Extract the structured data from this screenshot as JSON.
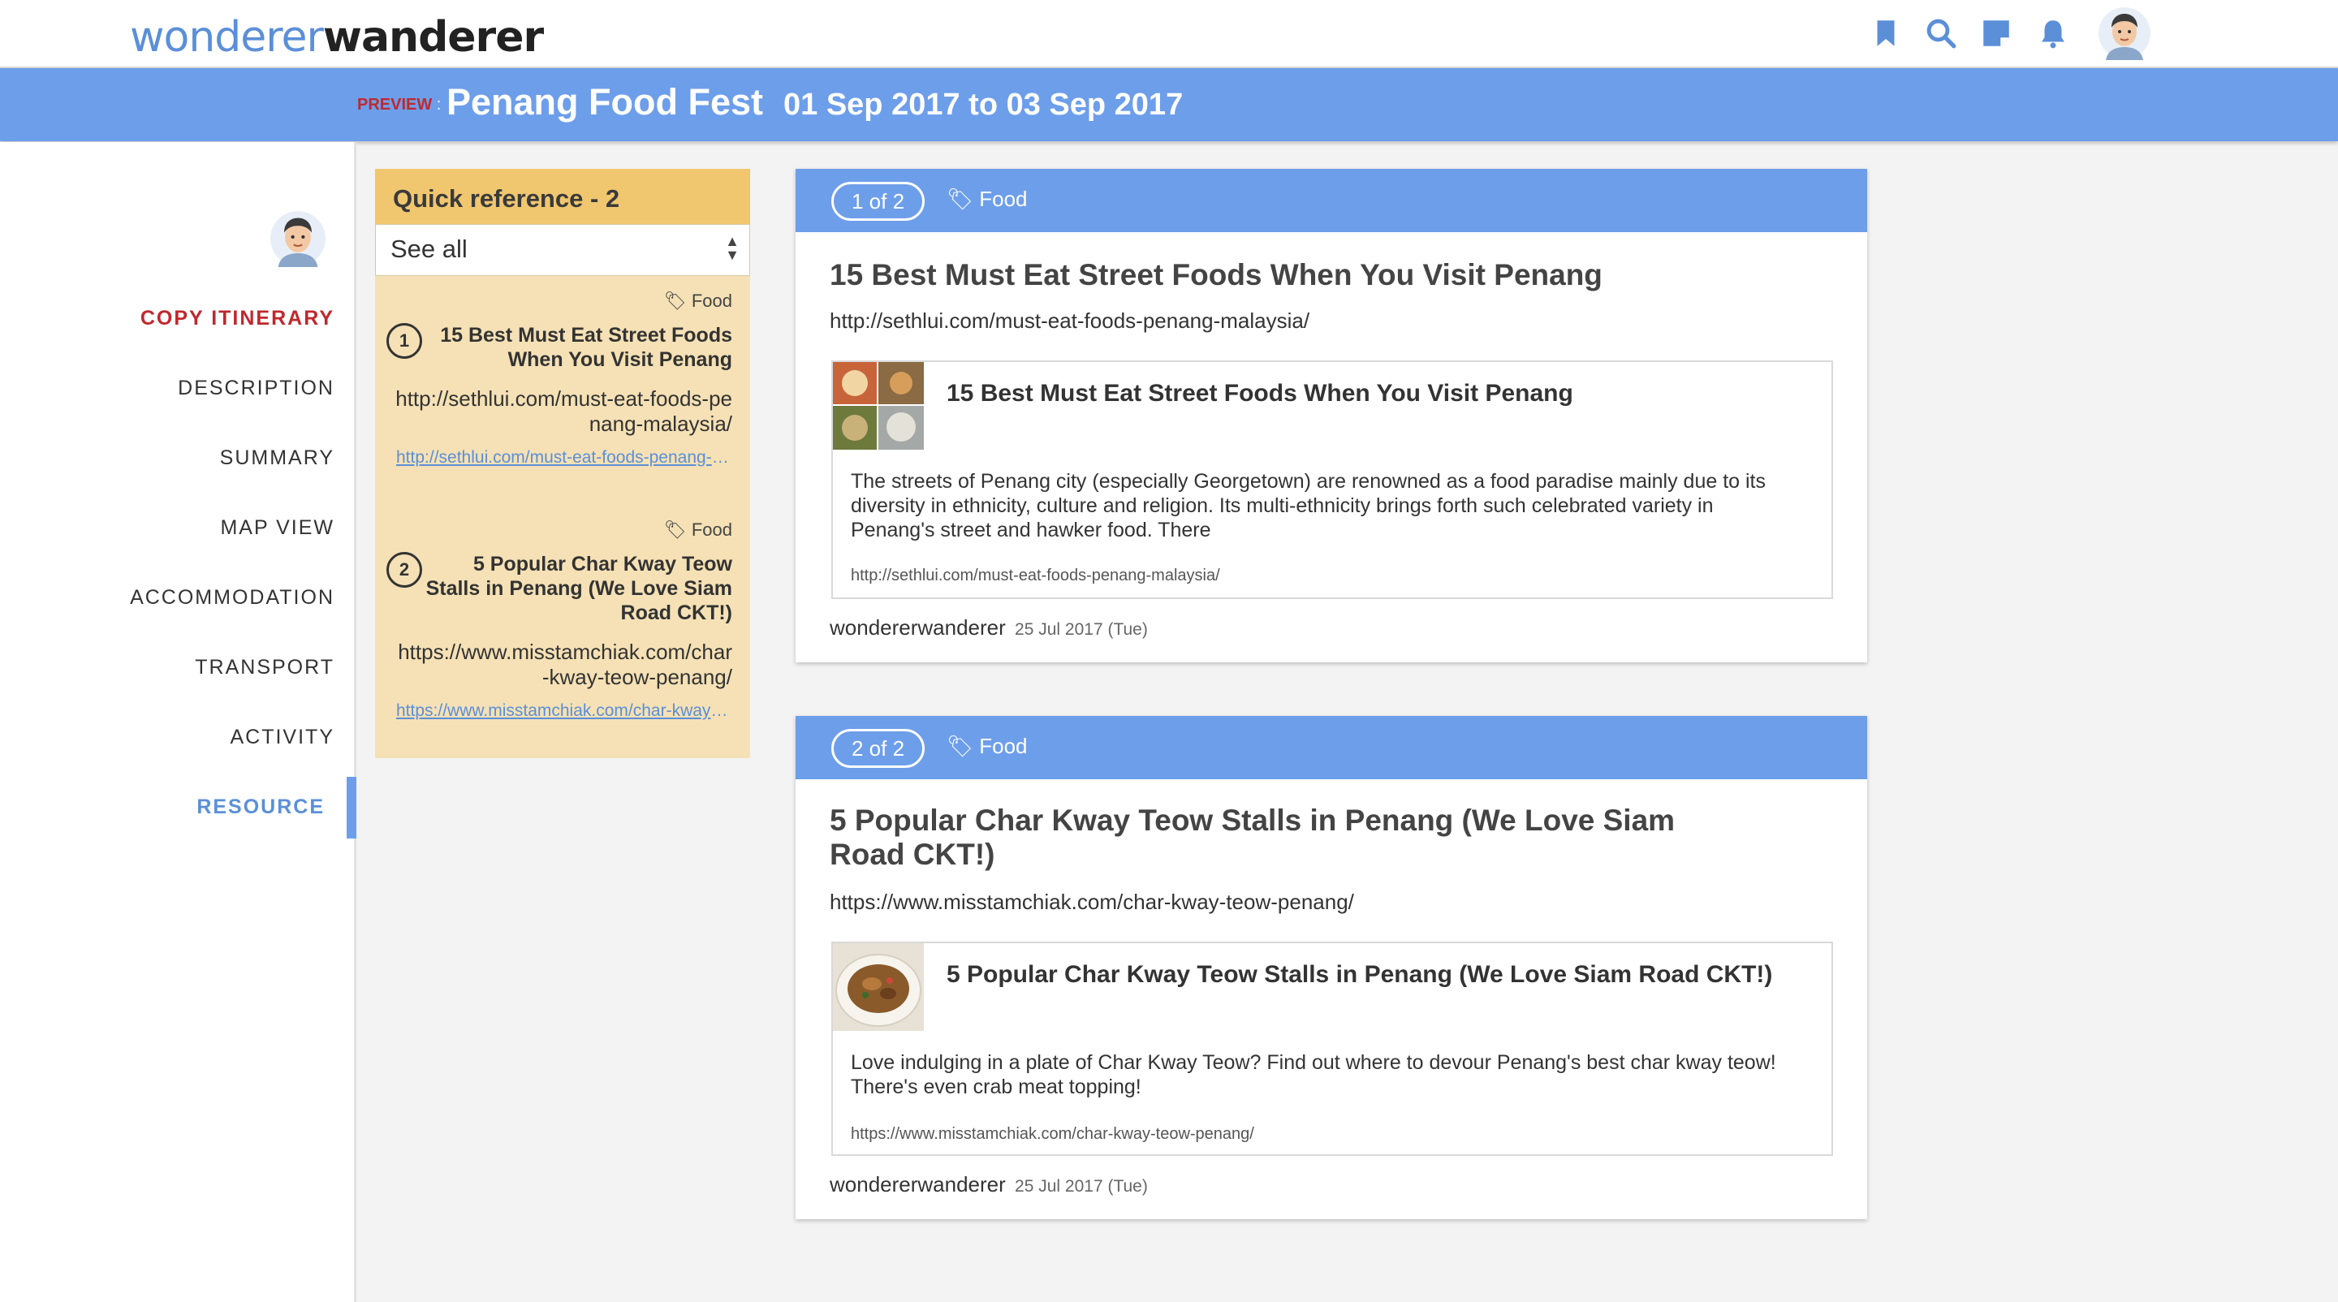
{
  "header": {
    "logo_part1": "wonderer",
    "logo_part2": "wanderer",
    "icons": [
      "bookmark-icon",
      "search-icon",
      "notes-icon",
      "bell-icon",
      "avatar"
    ]
  },
  "banner": {
    "preview_label": "PREVIEW",
    "preview_colon": " :",
    "title": "Penang Food Fest",
    "dates": "01 Sep 2017 to 03 Sep 2017"
  },
  "nav": {
    "items": [
      {
        "label": "COPY ITINERARY"
      },
      {
        "label": "DESCRIPTION"
      },
      {
        "label": "SUMMARY"
      },
      {
        "label": "MAP VIEW"
      },
      {
        "label": "ACCOMMODATION"
      },
      {
        "label": "TRANSPORT"
      },
      {
        "label": "ACTIVITY"
      },
      {
        "label": "RESOURCE"
      }
    ],
    "active": "RESOURCE"
  },
  "quickref": {
    "header": "Quick reference - 2",
    "filter_value": "See all",
    "items": [
      {
        "num": "1",
        "tag": "Food",
        "title": "15 Best Must Eat Street Foods When You Visit Penang",
        "url": "http://sethlui.com/must-eat-foods-penang-malaysia/",
        "link": "http://sethlui.com/must-eat-foods-penang-malaysia/"
      },
      {
        "num": "2",
        "tag": "Food",
        "title": "5 Popular Char Kway Teow Stalls in Penang (We Love Siam Road CKT!)",
        "url": "https://www.misstamchiak.com/char-kway-teow-penang/",
        "link": "https://www.misstamchiak.com/char-kway-teow-penang/"
      }
    ]
  },
  "cards": [
    {
      "counter": "1 of 2",
      "tag": "Food",
      "title": "15 Best Must Eat Street Foods When You Visit Penang",
      "url": "http://sethlui.com/must-eat-foods-penang-malaysia/",
      "preview_title": "15 Best Must Eat Street Foods When You Visit Penang",
      "preview_desc": "The streets of Penang city (especially Georgetown) are renowned as a food paradise mainly due to its diversity in ethnicity, culture and religion. Its multi-ethnicity brings forth such celebrated variety in Penang's street and hawker food. There",
      "preview_url": "http://sethlui.com/must-eat-foods-penang-malaysia/",
      "author": "wondererwanderer",
      "date": "25 Jul 2017 (Tue)"
    },
    {
      "counter": "2 of 2",
      "tag": "Food",
      "title": "5 Popular Char Kway Teow Stalls in Penang (We Love Siam Road CKT!)",
      "url": "https://www.misstamchiak.com/char-kway-teow-penang/",
      "preview_title": "5 Popular Char Kway Teow Stalls in Penang (We Love Siam Road CKT!)",
      "preview_desc": "Love indulging in a plate of Char Kway Teow? Find out where to devour Penang's best char kway teow! There's even crab meat topping!",
      "preview_url": "https://www.misstamchiak.com/char-kway-teow-penang/",
      "author": "wondererwanderer",
      "date": "25 Jul 2017 (Tue)"
    }
  ],
  "colors": {
    "accent_blue": "#6d9eea",
    "link_blue": "#5b8fd8",
    "copy_red": "#c0282d",
    "quickref_header": "#f0c66f",
    "quickref_body": "#f5e1b5"
  }
}
